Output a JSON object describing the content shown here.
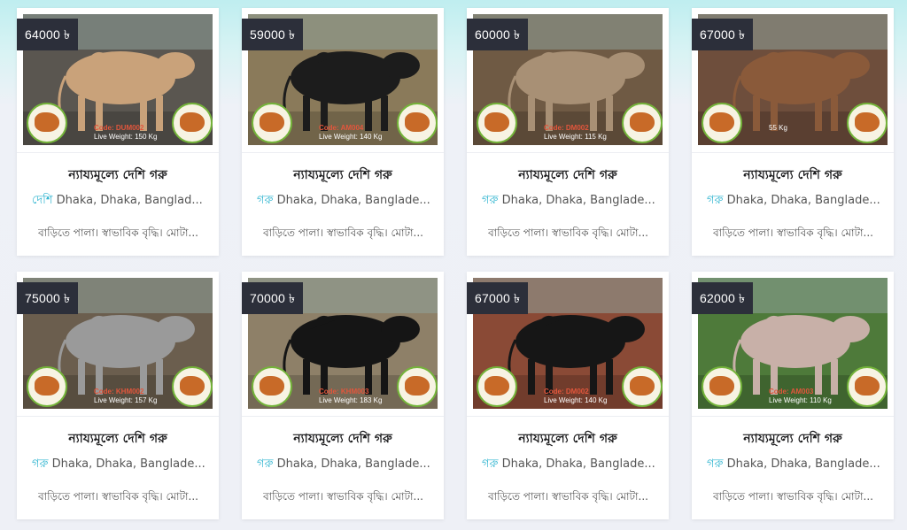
{
  "listings": [
    {
      "price": "64000 ৳",
      "title": "ন্যায্যমূল্যে দেশি গরু",
      "tag": "দেশি",
      "location": "Dhaka, Dhaka, Banglad...",
      "description": "বাড়িতে পালা। স্বাভাবিক বৃদ্ধি। মোটা...",
      "code": "Code: DUM002",
      "weight": "Live Weight: 150 Kg",
      "cow_color": "#c9a27a",
      "bg": "#5a5650"
    },
    {
      "price": "59000 ৳",
      "title": "ন্যায্যমূল্যে দেশি গরু",
      "tag": "গরু",
      "location": "Dhaka, Dhaka, Banglade...",
      "description": "বাড়িতে পালা। স্বাভাবিক বৃদ্ধি। মোটা...",
      "code": "Code: AM004",
      "weight": "Live Weight: 140 Kg",
      "cow_color": "#1c1c1c",
      "bg": "#8a7a5a"
    },
    {
      "price": "60000 ৳",
      "title": "ন্যায্যমূল্যে দেশি গরু",
      "tag": "গরু",
      "location": "Dhaka, Dhaka, Banglade...",
      "description": "বাড়িতে পালা। স্বাভাবিক বৃদ্ধি। মোটা...",
      "code": "Code: DM002",
      "weight": "Live Weight: 115 Kg",
      "cow_color": "#a89075",
      "bg": "#6f5a44"
    },
    {
      "price": "67000 ৳",
      "title": "ন্যায্যমূল্যে দেশি গরু",
      "tag": "গরু",
      "location": "Dhaka, Dhaka, Banglade...",
      "description": "বাড়িতে পালা। স্বাভাবিক বৃদ্ধি। মোটা...",
      "code": "",
      "weight": "55 Kg",
      "cow_color": "#8a5a3a",
      "bg": "#6e4e3c"
    },
    {
      "price": "75000 ৳",
      "title": "ন্যায্যমূল্যে দেশি গরু",
      "tag": "গরু",
      "location": "Dhaka, Dhaka, Banglade...",
      "description": "বাড়িতে পালা। স্বাভাবিক বৃদ্ধি। মোটা...",
      "code": "Code: KHM002",
      "weight": "Live Weight: 157 Kg",
      "cow_color": "#9a9a9a",
      "bg": "#6b5e4e"
    },
    {
      "price": "70000 ৳",
      "title": "ন্যায্যমূল্যে দেশি গরু",
      "tag": "গরু",
      "location": "Dhaka, Dhaka, Banglade...",
      "description": "বাড়িতে পালা। স্বাভাবিক বৃদ্ধি। মোটা...",
      "code": "Code: KHM003",
      "weight": "Live Weight: 183 Kg",
      "cow_color": "#151515",
      "bg": "#8e8068"
    },
    {
      "price": "67000 ৳",
      "title": "ন্যায্যমূল্যে দেশি গরু",
      "tag": "গরু",
      "location": "Dhaka, Dhaka, Banglade...",
      "description": "বাড়িতে পালা। স্বাভাবিক বৃদ্ধি। মোটা...",
      "code": "Code: DM002",
      "weight": "Live Weight: 140 Kg",
      "cow_color": "#161616",
      "bg": "#8a4a36"
    },
    {
      "price": "62000 ৳",
      "title": "ন্যায্যমূল্যে দেশি গরু",
      "tag": "গরু",
      "location": "Dhaka, Dhaka, Banglade...",
      "description": "বাড়িতে পালা। স্বাভাবিক বৃদ্ধি। মোটা...",
      "code": "Code: AM003",
      "weight": "Live Weight: 110 Kg",
      "cow_color": "#c8b0a8",
      "bg": "#4e7a3a"
    }
  ]
}
